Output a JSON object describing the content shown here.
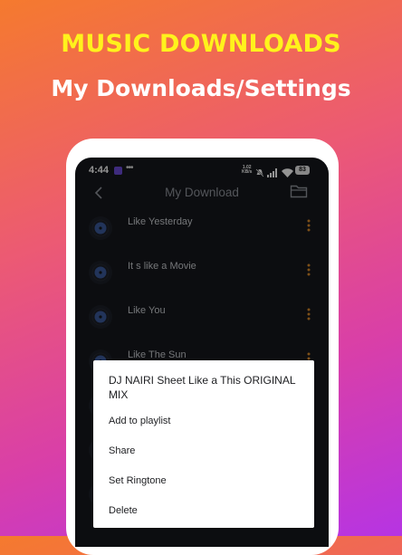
{
  "promo": {
    "title": "MUSIC DOWNLOADS",
    "subtitle": "My Downloads/Settings"
  },
  "status_bar": {
    "time": "4:44",
    "dots": "•••",
    "speed_value": "1.02",
    "speed_unit": "KB/s",
    "battery": "83"
  },
  "header": {
    "title": "My Download",
    "back_icon": "chevron-left-icon",
    "folder_icon": "folder-icon"
  },
  "songs": [
    {
      "title": "Like Yesterday"
    },
    {
      "title": "It s like a Movie"
    },
    {
      "title": "Like You"
    },
    {
      "title": "Like The Sun"
    }
  ],
  "context_menu": {
    "title": "DJ NAIRI Sheet Like a This ORIGINAL MIX",
    "items": [
      {
        "label": "Add to playlist"
      },
      {
        "label": "Share"
      },
      {
        "label": "Set Ringtone"
      },
      {
        "label": "Delete"
      }
    ]
  },
  "colors": {
    "promo_title": "#fff21c",
    "screen_bg": "#16181c",
    "accent_orange": "#d98a2a"
  }
}
